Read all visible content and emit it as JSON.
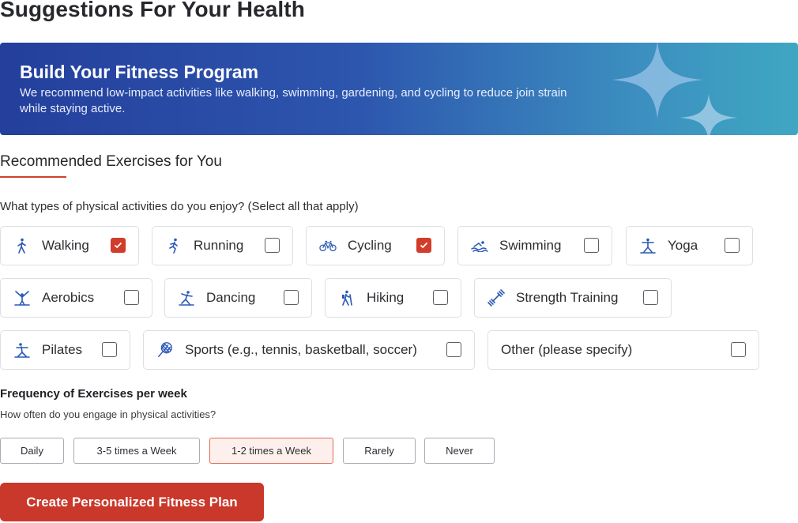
{
  "page": {
    "title": "Suggestions For Your Health"
  },
  "banner": {
    "title": "Build Your Fitness Program",
    "description": "We recommend low-impact activities like walking, swimming, gardening, and cycling to reduce join strain while staying active."
  },
  "section": {
    "title": "Recommended Exercises for You"
  },
  "activities": {
    "question": "What types of physical activities do you enjoy? (Select all that apply)",
    "items": [
      {
        "label": "Walking",
        "icon": "walking-icon",
        "checked": true
      },
      {
        "label": "Running",
        "icon": "running-icon",
        "checked": false
      },
      {
        "label": "Cycling",
        "icon": "bicycle-icon",
        "checked": true
      },
      {
        "label": "Swimming",
        "icon": "swimming-icon",
        "checked": false
      },
      {
        "label": "Yoga",
        "icon": "yoga-icon",
        "checked": false
      },
      {
        "label": "Aerobics",
        "icon": "aerobics-icon",
        "checked": false
      },
      {
        "label": "Dancing",
        "icon": "dancing-icon",
        "checked": false
      },
      {
        "label": "Hiking",
        "icon": "hiking-icon",
        "checked": false
      },
      {
        "label": "Strength Training",
        "icon": "dumbbell-icon",
        "checked": false
      },
      {
        "label": "Pilates",
        "icon": "pilates-icon",
        "checked": false
      },
      {
        "label": "Sports (e.g., tennis, basketball, soccer)",
        "icon": "tennis-racket-icon",
        "checked": false
      },
      {
        "label": "Other (please specify)",
        "icon": "",
        "checked": false
      }
    ]
  },
  "frequency": {
    "title": "Frequency of Exercises per week",
    "question": "How often do you engage in physical activities?",
    "options": [
      "Daily",
      "3-5 times a Week",
      "1-2 times a Week",
      "Rarely",
      "Never"
    ],
    "selected": "1-2 times a Week"
  },
  "cta": {
    "label": "Create Personalized Fitness Plan"
  },
  "colors": {
    "accent": "#d13d2a",
    "icon": "#2a58b8",
    "banner_start": "#243f9c",
    "banner_end": "#3fa7c2"
  }
}
